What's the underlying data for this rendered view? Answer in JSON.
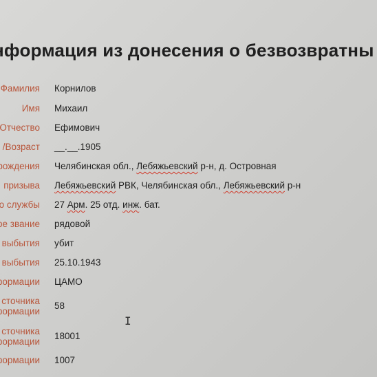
{
  "title": "нформация из донесения о безвозвратны",
  "fields": [
    {
      "label": "Фамилия",
      "value": "Корнилов"
    },
    {
      "label": "Имя",
      "value": "Михаил"
    },
    {
      "label": "Отчество",
      "value": "Ефимович"
    },
    {
      "label": "/Возраст",
      "value": "__.__.1905"
    },
    {
      "label": "рождения",
      "value_parts": [
        "Челябинская обл., ",
        "Лебяжьевский",
        " р-н, д. Островная"
      ]
    },
    {
      "label": "призыва",
      "value_parts": [
        "Лебяжьевский",
        " РВК, Челябинская обл., ",
        "Лебяжьевский",
        " р-н"
      ]
    },
    {
      "label": "о службы",
      "value_parts": [
        "27 ",
        "Арм",
        ". 25 отд. ",
        "инж",
        ". бат."
      ]
    },
    {
      "label": "ое звание",
      "value": "рядовой"
    },
    {
      "label": "выбытия",
      "value": "убит"
    },
    {
      "label": "выбытия",
      "value": "25.10.1943"
    },
    {
      "label": "формации",
      "value": "ЦАМО"
    },
    {
      "label_lines": [
        "сточника",
        "формации"
      ],
      "value": "58"
    },
    {
      "label_lines": [
        "сточника",
        "формации"
      ],
      "value": "18001"
    },
    {
      "label": "формации",
      "value": "1007"
    }
  ],
  "cursor": "I"
}
